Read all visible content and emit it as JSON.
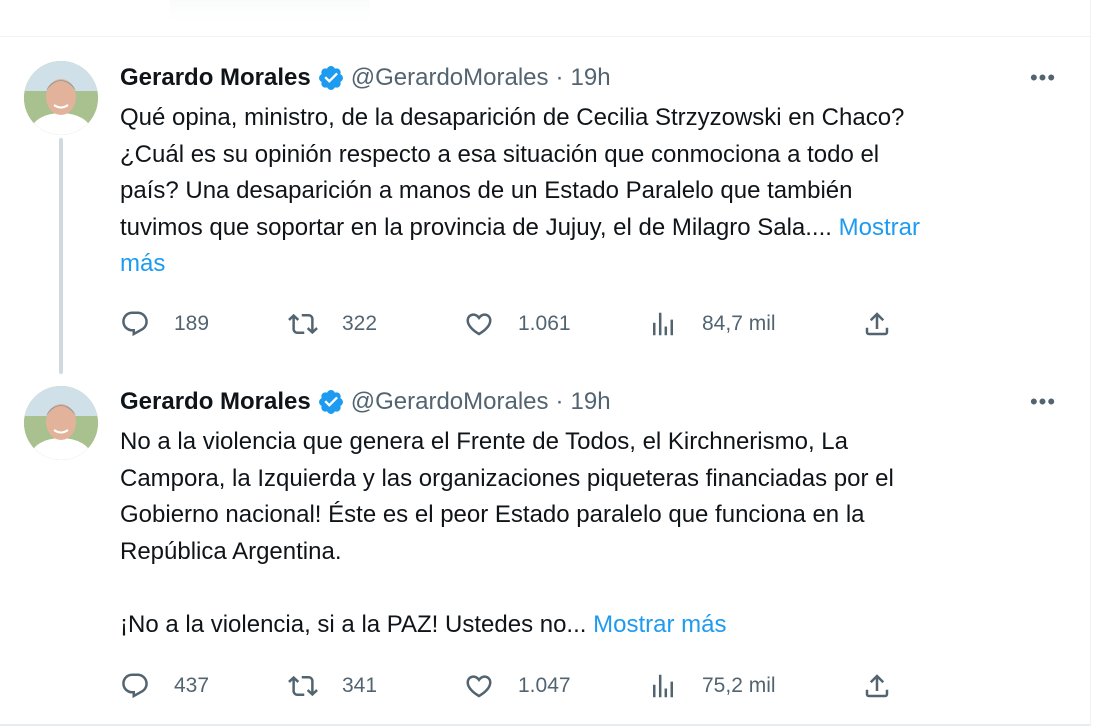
{
  "tweets": [
    {
      "author": "Gerardo Morales",
      "handle": "@GerardoMorales",
      "separator": "·",
      "time": "19h",
      "more_label": "•••",
      "text_lines": [
        "Qué opina, ministro, de la desaparición de Cecilia Strzyzowski en Chaco?",
        "¿Cuál es su opinión respecto a esa situación que conmociona a todo el",
        "país? Una desaparición a manos de un Estado Paralelo que también",
        "tuvimos que soportar en la provincia de Jujuy, el de Milagro Sala...."
      ],
      "show_more_inline": "Mostrar",
      "show_more_wrap": "más",
      "replies": "189",
      "retweets": "322",
      "likes": "1.061",
      "views": "84,7 mil"
    },
    {
      "author": "Gerardo Morales",
      "handle": "@GerardoMorales",
      "separator": "·",
      "time": "19h",
      "more_label": "•••",
      "text_lines": [
        "No a la violencia que genera el Frente de Todos, el Kirchnerismo, La",
        "Campora, la Izquierda y las organizaciones piqueteras financiadas por el",
        "Gobierno nacional! Éste es el peor Estado paralelo que funciona en la",
        "República Argentina."
      ],
      "text_last": "¡No a la violencia, si a la PAZ! Ustedes no...",
      "show_more": "Mostrar más",
      "replies": "437",
      "retweets": "341",
      "likes": "1.047",
      "views": "75,2 mil"
    }
  ],
  "icons": {
    "verified": "verified-badge-icon",
    "reply": "reply-icon",
    "retweet": "retweet-icon",
    "like": "like-icon",
    "views": "views-icon",
    "share": "share-icon"
  },
  "colors": {
    "text": "#0f1419",
    "secondary": "#536471",
    "link": "#1d9bf0",
    "divider": "#eff3f4",
    "thread_line": "#cfd9de"
  }
}
